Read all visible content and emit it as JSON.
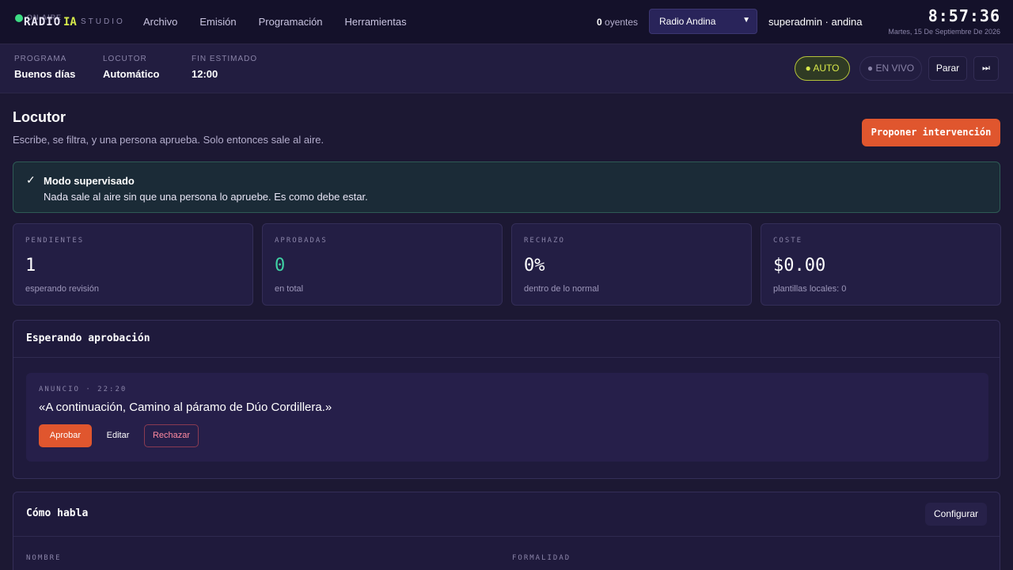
{
  "topbar": {
    "logo": {
      "onair": "ON AIRE",
      "radio": "RADIO",
      "ia": "IA",
      "studio": "STUDIO"
    },
    "nav": [
      "Archivo",
      "Emisión",
      "Programación",
      "Herramientas"
    ],
    "listeners_count": "0",
    "listeners_label": "oyentes",
    "station": "Radio Andina",
    "user": "superadmin · andina",
    "clock_time": "8:57:36",
    "clock_date": "Martes, 15 De Septiembre De 2026"
  },
  "program": {
    "fields": [
      {
        "label": "PROGRAMA",
        "value": "Buenos días"
      },
      {
        "label": "LOCUTOR",
        "value": "Automático"
      },
      {
        "label": "FIN ESTIMADO",
        "value": "12:00"
      }
    ],
    "auto_label": "● AUTO",
    "live_label": "● EN VIVO",
    "stop_label": "Parar",
    "skip_label": "⏭"
  },
  "page": {
    "title": "Locutor",
    "subtitle": "Escribe, se filtra, y una persona aprueba. Solo entonces sale al aire.",
    "propose_label": "Proponer intervención"
  },
  "notice": {
    "check": "✓",
    "title": "Modo supervisado",
    "description": "Nada sale al aire sin que una persona lo apruebe. Es como debe estar."
  },
  "stats": [
    {
      "label": "PENDIENTES",
      "value": "1",
      "sub": "esperando revisión",
      "color": "#ffffff"
    },
    {
      "label": "APROBADAS",
      "value": "0",
      "sub": "en total",
      "color": "#3fd2a4"
    },
    {
      "label": "RECHAZO",
      "value": "0%",
      "sub": "dentro de lo normal",
      "color": "#ffffff"
    },
    {
      "label": "COSTE",
      "value": "$0.00",
      "sub": "plantillas locales: 0",
      "color": "#ffffff"
    }
  ],
  "approval": {
    "header": "Esperando aprobación",
    "item": {
      "meta": "ANUNCIO · 22:20",
      "quote": "«A continuación, Camino al páramo de Dúo Cordillera.»",
      "approve_label": "Aprobar",
      "edit_label": "Editar",
      "reject_label": "Rechazar"
    }
  },
  "voice": {
    "header": "Cómo habla",
    "config_label": "Configurar",
    "fields": [
      {
        "label": "NOMBRE"
      },
      {
        "label": "FORMALIDAD"
      }
    ]
  }
}
